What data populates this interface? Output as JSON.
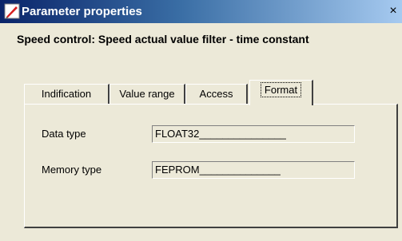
{
  "window": {
    "title": "Parameter properties",
    "close_glyph": "×",
    "icon": "app-icon"
  },
  "heading": "Speed control: Speed actual value filter - time constant",
  "tabs": [
    {
      "label": "Indification",
      "active": false
    },
    {
      "label": "Value range",
      "active": false
    },
    {
      "label": "Access",
      "active": false
    },
    {
      "label": "Format",
      "active": true
    }
  ],
  "format": {
    "data_type_label": "Data type",
    "data_type_value": "FLOAT32_______________",
    "memory_type_label": "Memory type",
    "memory_type_value": "FEPROM______________"
  }
}
